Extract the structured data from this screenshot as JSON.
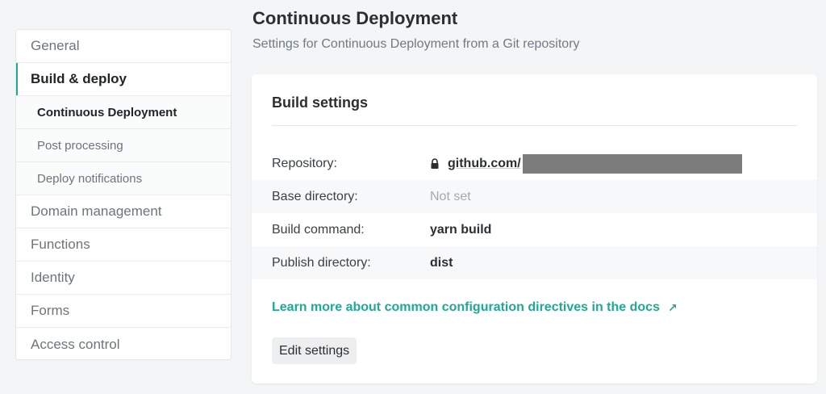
{
  "sidebar": {
    "items": [
      {
        "label": "General",
        "state": "normal"
      },
      {
        "label": "Build & deploy",
        "state": "active"
      },
      {
        "label": "Continuous Deployment",
        "state": "sub-current"
      },
      {
        "label": "Post processing",
        "state": "sub"
      },
      {
        "label": "Deploy notifications",
        "state": "sub"
      },
      {
        "label": "Domain management",
        "state": "normal"
      },
      {
        "label": "Functions",
        "state": "normal"
      },
      {
        "label": "Identity",
        "state": "normal"
      },
      {
        "label": "Forms",
        "state": "normal"
      },
      {
        "label": "Access control",
        "state": "normal"
      }
    ]
  },
  "header": {
    "title": "Continuous Deployment",
    "subtitle": "Settings for Continuous Deployment from a Git repository"
  },
  "build_settings": {
    "title": "Build settings",
    "rows": [
      {
        "label": "Repository:",
        "value": "github.com/",
        "redacted": true,
        "icon": "lock-icon"
      },
      {
        "label": "Base directory:",
        "value": "Not set",
        "muted": true
      },
      {
        "label": "Build command:",
        "value": "yarn build"
      },
      {
        "label": "Publish directory:",
        "value": "dist"
      }
    ],
    "docs_link": "Learn more about common configuration directives in the docs",
    "docs_link_icon": "external-arrow-icon",
    "edit_button": "Edit settings"
  },
  "colors": {
    "accent": "#21a79a",
    "link": "#1fa896",
    "background": "#f4f5f6"
  }
}
